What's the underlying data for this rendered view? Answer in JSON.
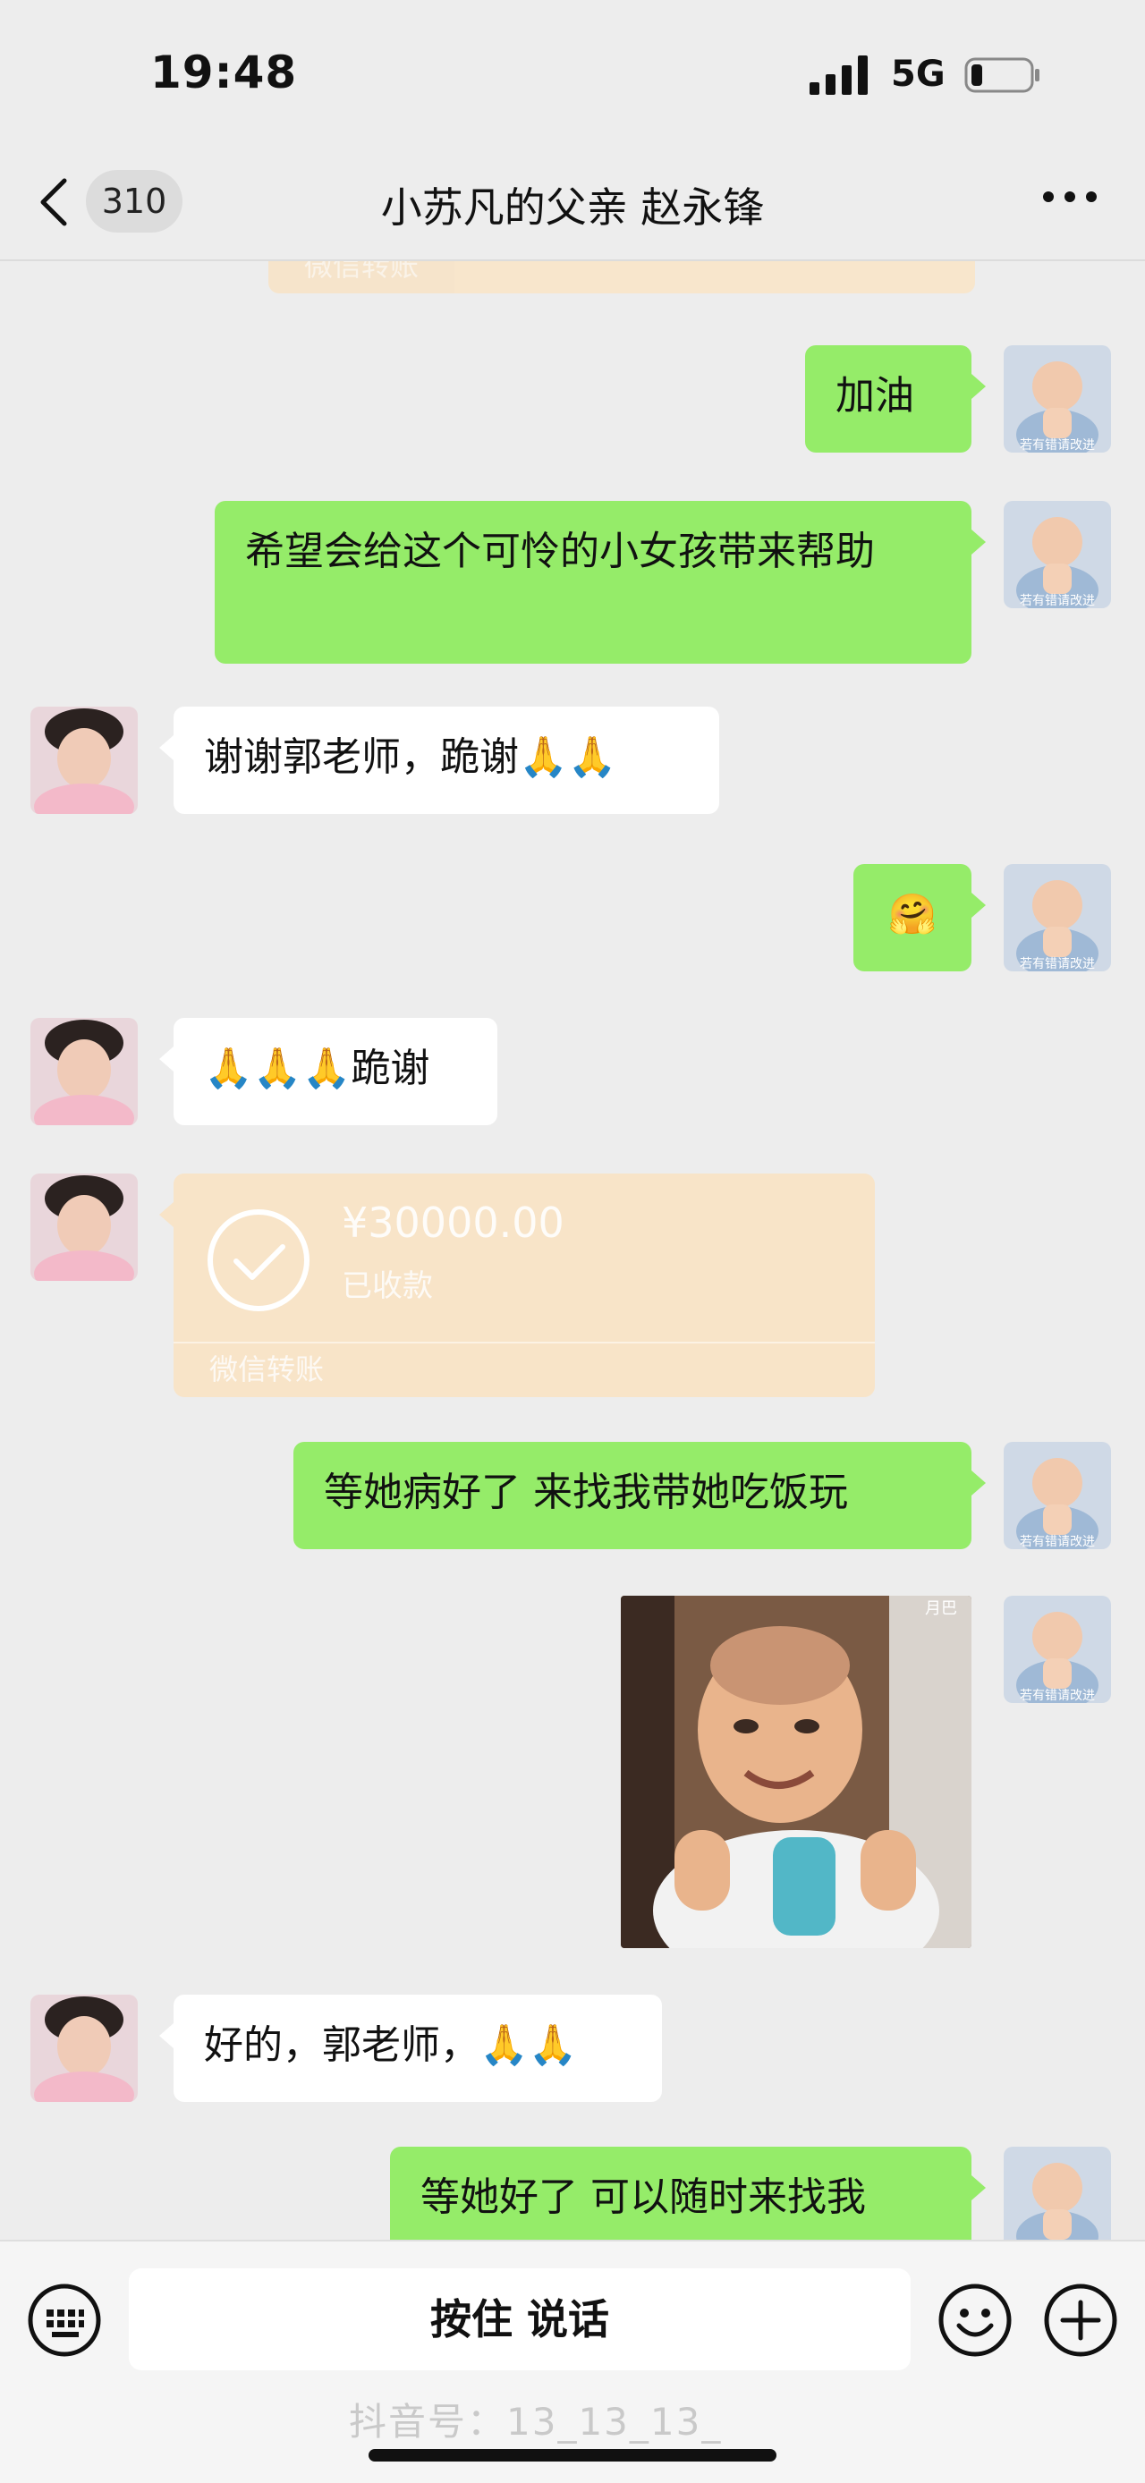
{
  "status_bar": {
    "time": "19:48",
    "network": "5G"
  },
  "nav": {
    "badge": "310",
    "title": "小苏凡的父亲 赵永锋"
  },
  "top_partial": {
    "text": "微信转账"
  },
  "messages": [
    {
      "side": "right",
      "text": "加油"
    },
    {
      "side": "right",
      "text": "希望会给这个可怜的小女孩带来帮助"
    },
    {
      "side": "left",
      "text": "谢谢郭老师，跪谢🙏🙏"
    },
    {
      "side": "right",
      "text": "🤗"
    },
    {
      "side": "left",
      "text": "🙏🙏🙏跪谢"
    },
    {
      "side": "left",
      "type": "transfer",
      "amount": "¥30000.00",
      "state": "已收款",
      "label": "微信转账"
    },
    {
      "side": "right",
      "text": "等她病好了 来找我带她吃饭玩"
    },
    {
      "side": "right",
      "type": "sticker",
      "corner": "月巴"
    },
    {
      "side": "left",
      "text": "好的，郭老师，🙏🙏"
    },
    {
      "side": "right",
      "text": "等她好了 可以随时来找我"
    }
  ],
  "avatar_caption": "若有错请改进",
  "input": {
    "hold_to_talk": "按住 说话"
  },
  "watermark": "抖音号：13_13_13_",
  "colors": {
    "bubble_green": "#95ec69",
    "bubble_white": "#ffffff",
    "transfer_orange": "#f8e4c8",
    "background": "#ededed"
  },
  "icons": [
    "back-chevron-icon",
    "more-icon",
    "keyboard-icon",
    "emoji-icon",
    "plus-icon",
    "signal-icon",
    "battery-icon"
  ]
}
